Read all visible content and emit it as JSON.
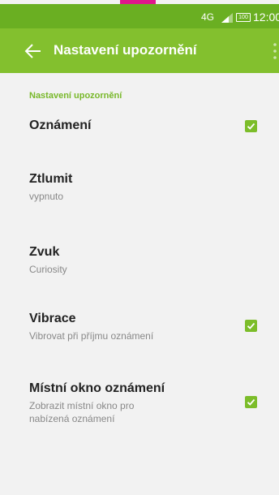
{
  "status_bar": {
    "network": "4G",
    "battery": "100",
    "time": "12:00"
  },
  "app_bar": {
    "title": "Nastavení upozornění"
  },
  "section": {
    "header": "Nastavení upozornění"
  },
  "preferences": [
    {
      "title": "Oznámení",
      "checked": true
    },
    {
      "title": "Ztlumit",
      "summary": "vypnuto"
    },
    {
      "title": "Zvuk",
      "summary": "Curiosity"
    },
    {
      "title": "Vibrace",
      "summary": "Vibrovat při příjmu oznámení",
      "checked": true
    },
    {
      "title": "Místní okno oznámení",
      "summary_line1": "Zobrazit místní okno pro",
      "summary_line2": "nabízená oznámení",
      "checked": true
    }
  ],
  "colors": {
    "status_bar": "#6aaf22",
    "app_bar": "#83c02e",
    "accent": "#7cbd2a",
    "background": "#f2f2f2"
  }
}
